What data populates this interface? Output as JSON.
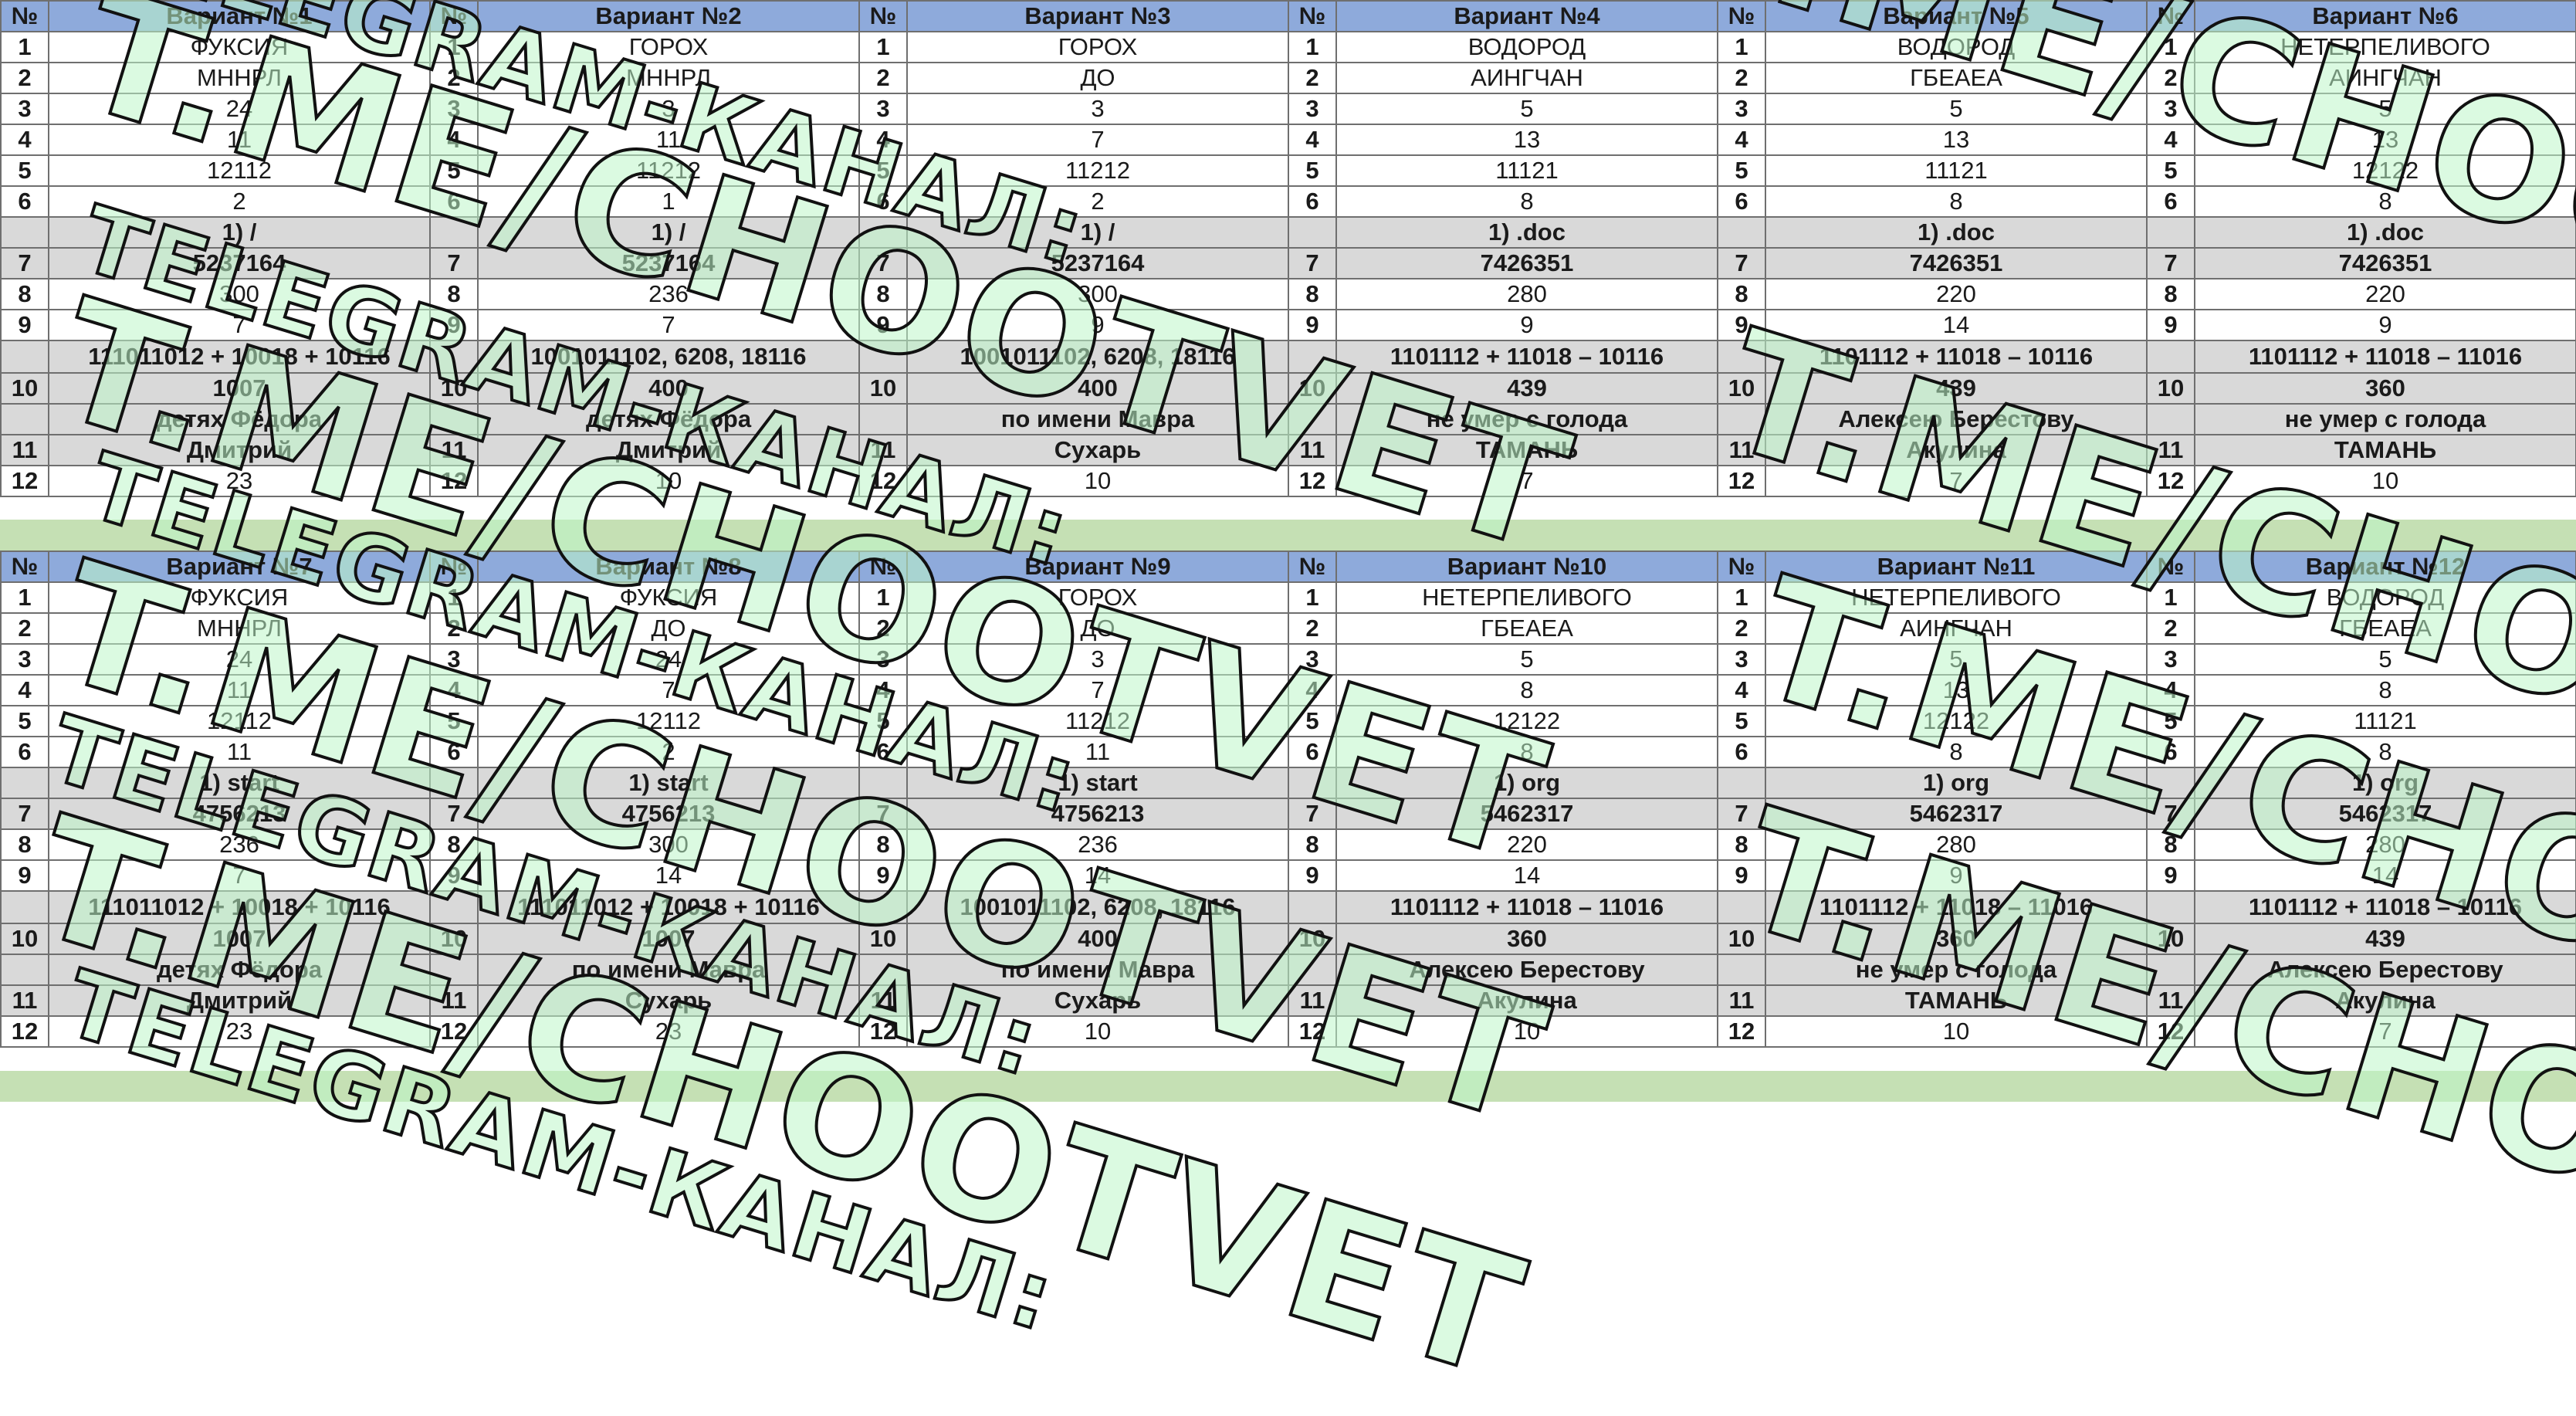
{
  "column_header": "№",
  "row_numbers_top": [
    "1",
    "2",
    "3",
    "4",
    "5",
    "6",
    "",
    "7",
    "8",
    "9",
    "",
    "10",
    "",
    "11",
    "12"
  ],
  "row_numbers_bottom": [
    "1",
    "2",
    "3",
    "4",
    "5",
    "6",
    "",
    "7",
    "8",
    "9",
    "",
    "10",
    "",
    "11",
    "12"
  ],
  "watermark": {
    "channel_label": "TELEGRAM-КАНАЛ:",
    "channel_link": "T.ME/CHOOTVET"
  },
  "variants_top": [
    {
      "title": "Вариант №1",
      "values": [
        "ФУКСИЯ",
        "МННРЛ",
        "24",
        "11",
        "12112",
        "2",
        "1) /",
        "5237164",
        "300",
        "7"
      ],
      "expr_main": "111011012 + 10018 + 10116",
      "q10": "1007",
      "q11a": "детях Фёдора",
      "q11b": "Дмитрий",
      "q12": "23"
    },
    {
      "title": "Вариант №2",
      "values": [
        "ГОРОХ",
        "МННРЛ",
        "3",
        "11",
        "11212",
        "1",
        "1) /",
        "5237164",
        "236",
        "7"
      ],
      "expr_main": "1001011102, 6208, 18116",
      "q10": "400",
      "q11a": "детях Фёдора",
      "q11b": "Дмитрий",
      "q12": "10"
    },
    {
      "title": "Вариант №3",
      "values": [
        "ГОРОХ",
        "ДО",
        "3",
        "7",
        "11212",
        "2",
        "1) /",
        "5237164",
        "300",
        "9"
      ],
      "expr_main": "1001011102, 6208, 18116",
      "q10": "400",
      "q11a": "по имени Мавра",
      "q11b": "Сухарь",
      "q12": "10"
    },
    {
      "title": "Вариант №4",
      "values": [
        "ВОДОРОД",
        "АИНГЧАН",
        "5",
        "13",
        "11121",
        "8",
        "1) .doc",
        "7426351",
        "280",
        "9"
      ],
      "expr_main": "1101112 + 11018 – 10116",
      "q10": "439",
      "q11a": "не умер с голода",
      "q11b": "ТАМАНЬ",
      "q12": "7"
    },
    {
      "title": "Вариант №5",
      "values": [
        "ВОДОРОД",
        "ГБЕАЕА",
        "5",
        "13",
        "11121",
        "8",
        "1) .doc",
        "7426351",
        "220",
        "14"
      ],
      "expr_main": "1101112 + 11018 – 10116",
      "q10": "439",
      "q11a": "Алексею Берестову",
      "q11b": "Акулина",
      "q12": "7"
    },
    {
      "title": "Вариант №6",
      "values": [
        "НЕТЕРПЕЛИВОГО",
        "АИНГЧАН",
        "5",
        "13",
        "12122",
        "8",
        "1) .doc",
        "7426351",
        "220",
        "9"
      ],
      "expr_main": "1101112 + 11018 – 11016",
      "q10": "360",
      "q11a": "не умер с голода",
      "q11b": "ТАМАНЬ",
      "q12": "10"
    }
  ],
  "variants_bottom": [
    {
      "title": "Вариант №7",
      "values": [
        "ФУКСИЯ",
        "МННРЛ",
        "24",
        "11",
        "12112",
        "11",
        "1) start",
        "4756213",
        "236",
        "7"
      ],
      "expr_main": "111011012 + 10018 + 10116",
      "q10": "1007",
      "q11a": "детях Фёдора",
      "q11b": "Дмитрий",
      "q12": "23"
    },
    {
      "title": "Вариант №8",
      "values": [
        "ФУКСИЯ",
        "ДО",
        "24",
        "7",
        "12112",
        "2",
        "1) start",
        "4756213",
        "300",
        "14"
      ],
      "expr_main": "111011012 + 10018 + 10116",
      "q10": "1007",
      "q11a": "по имени Мавра",
      "q11b": "Сухарь",
      "q12": "23"
    },
    {
      "title": "Вариант №9",
      "values": [
        "ГОРОХ",
        "ДО",
        "3",
        "7",
        "11212",
        "11",
        "1) start",
        "4756213",
        "236",
        "14"
      ],
      "expr_main": "1001011102, 6208, 18116",
      "q10": "400",
      "q11a": "по имени Мавра",
      "q11b": "Сухарь",
      "q12": "10"
    },
    {
      "title": "Вариант №10",
      "values": [
        "НЕТЕРПЕЛИВОГО",
        "ГБЕАЕА",
        "5",
        "8",
        "12122",
        "8",
        "1) org",
        "5462317",
        "220",
        "14"
      ],
      "expr_main": "1101112 + 11018 – 11016",
      "q10": "360",
      "q11a": "Алексею Берестову",
      "q11b": "Акулина",
      "q12": "10"
    },
    {
      "title": "Вариант №11",
      "values": [
        "НЕТЕРПЕЛИВОГО",
        "АИНГЧАН",
        "5",
        "13",
        "12122",
        "8",
        "1) org",
        "5462317",
        "280",
        "9"
      ],
      "expr_main": "1101112 + 11018 – 11016",
      "q10": "360",
      "q11a": "не умер с голода",
      "q11b": "ТАМАНЬ",
      "q12": "10"
    },
    {
      "title": "Вариант №12",
      "values": [
        "ВОДОРОД",
        "ГБЕАЕА",
        "5",
        "8",
        "11121",
        "8",
        "1) org",
        "5462317",
        "280",
        "14"
      ],
      "expr_main": "1101112 + 11018 – 10116",
      "q10": "439",
      "q11a": "Алексею Берестову",
      "q11b": "Акулина",
      "q12": "7"
    }
  ]
}
